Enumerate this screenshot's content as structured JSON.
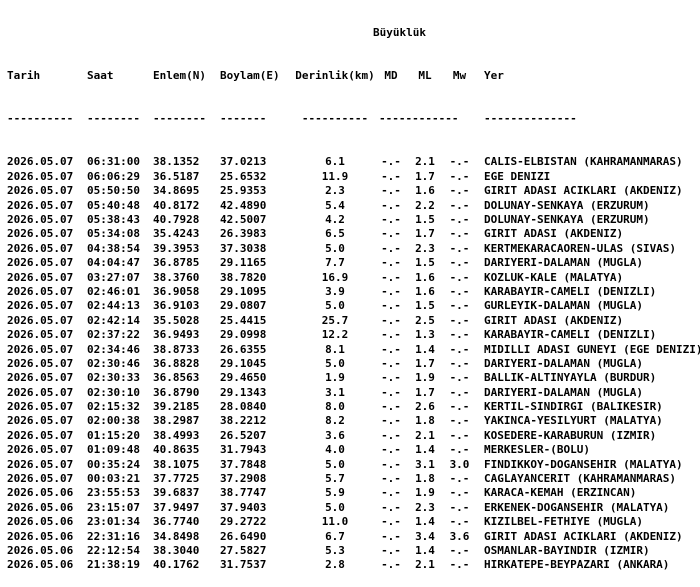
{
  "header": {
    "magnitude_group": "Büyüklük",
    "columns": {
      "date": "Tarih",
      "time": "Saat",
      "lat": "Enlem(N)",
      "lon": "Boylam(E)",
      "depth": "Derinlik(km)",
      "md": "MD",
      "ml": "ML",
      "mw": "Mw",
      "place": "Yer"
    },
    "rules": {
      "date": "----------",
      "time": "--------",
      "lat": "--------",
      "lon": "-------",
      "depth": "----------",
      "md": "------------",
      "ml": "",
      "mw": "",
      "place": "--------------"
    }
  },
  "rows": [
    {
      "date": "2026.05.07",
      "time": "06:31:00",
      "lat": "38.1352",
      "lon": "37.0213",
      "depth": "6.1",
      "md": "-.-",
      "ml": "2.1",
      "mw": "-.-",
      "place": "CALIS-ELBISTAN (KAHRAMANMARAS)"
    },
    {
      "date": "2026.05.07",
      "time": "06:06:29",
      "lat": "36.5187",
      "lon": "25.6532",
      "depth": "11.9",
      "md": "-.-",
      "ml": "1.7",
      "mw": "-.-",
      "place": "EGE DENIZI"
    },
    {
      "date": "2026.05.07",
      "time": "05:50:50",
      "lat": "34.8695",
      "lon": "25.9353",
      "depth": "2.3",
      "md": "-.-",
      "ml": "1.6",
      "mw": "-.-",
      "place": "GIRIT ADASI ACIKLARI (AKDENIZ)"
    },
    {
      "date": "2026.05.07",
      "time": "05:40:48",
      "lat": "40.8172",
      "lon": "42.4890",
      "depth": "5.4",
      "md": "-.-",
      "ml": "2.2",
      "mw": "-.-",
      "place": "DOLUNAY-SENKAYA (ERZURUM)"
    },
    {
      "date": "2026.05.07",
      "time": "05:38:43",
      "lat": "40.7928",
      "lon": "42.5007",
      "depth": "4.2",
      "md": "-.-",
      "ml": "1.5",
      "mw": "-.-",
      "place": "DOLUNAY-SENKAYA (ERZURUM)"
    },
    {
      "date": "2026.05.07",
      "time": "05:34:08",
      "lat": "35.4243",
      "lon": "26.3983",
      "depth": "6.5",
      "md": "-.-",
      "ml": "1.7",
      "mw": "-.-",
      "place": "GIRIT ADASI (AKDENIZ)"
    },
    {
      "date": "2026.05.07",
      "time": "04:38:54",
      "lat": "39.3953",
      "lon": "37.3038",
      "depth": "5.0",
      "md": "-.-",
      "ml": "2.3",
      "mw": "-.-",
      "place": "KERTMEKARACAOREN-ULAS (SIVAS)"
    },
    {
      "date": "2026.05.07",
      "time": "04:04:47",
      "lat": "36.8785",
      "lon": "29.1165",
      "depth": "7.7",
      "md": "-.-",
      "ml": "1.5",
      "mw": "-.-",
      "place": "DARIYERI-DALAMAN (MUGLA)"
    },
    {
      "date": "2026.05.07",
      "time": "03:27:07",
      "lat": "38.3760",
      "lon": "38.7820",
      "depth": "16.9",
      "md": "-.-",
      "ml": "1.6",
      "mw": "-.-",
      "place": "KOZLUK-KALE (MALATYA)"
    },
    {
      "date": "2026.05.07",
      "time": "02:46:01",
      "lat": "36.9058",
      "lon": "29.1095",
      "depth": "3.9",
      "md": "-.-",
      "ml": "1.6",
      "mw": "-.-",
      "place": "KARABAYIR-CAMELI (DENIZLI)"
    },
    {
      "date": "2026.05.07",
      "time": "02:44:13",
      "lat": "36.9103",
      "lon": "29.0807",
      "depth": "5.0",
      "md": "-.-",
      "ml": "1.5",
      "mw": "-.-",
      "place": "GURLEYIK-DALAMAN (MUGLA)"
    },
    {
      "date": "2026.05.07",
      "time": "02:42:14",
      "lat": "35.5028",
      "lon": "25.4415",
      "depth": "25.7",
      "md": "-.-",
      "ml": "2.5",
      "mw": "-.-",
      "place": "GIRIT ADASI (AKDENIZ)"
    },
    {
      "date": "2026.05.07",
      "time": "02:37:22",
      "lat": "36.9493",
      "lon": "29.0998",
      "depth": "12.2",
      "md": "-.-",
      "ml": "1.3",
      "mw": "-.-",
      "place": "KARABAYIR-CAMELI (DENIZLI)"
    },
    {
      "date": "2026.05.07",
      "time": "02:34:46",
      "lat": "38.8733",
      "lon": "26.6355",
      "depth": "8.1",
      "md": "-.-",
      "ml": "1.4",
      "mw": "-.-",
      "place": "MIDILLI ADASI GUNEYI (EGE DENIZI)"
    },
    {
      "date": "2026.05.07",
      "time": "02:30:46",
      "lat": "36.8828",
      "lon": "29.1045",
      "depth": "5.0",
      "md": "-.-",
      "ml": "1.7",
      "mw": "-.-",
      "place": "DARIYERI-DALAMAN (MUGLA)"
    },
    {
      "date": "2026.05.07",
      "time": "02:30:33",
      "lat": "36.8563",
      "lon": "29.4650",
      "depth": "1.9",
      "md": "-.-",
      "ml": "1.9",
      "mw": "-.-",
      "place": "BALLIK-ALTINYAYLA (BURDUR)"
    },
    {
      "date": "2026.05.07",
      "time": "02:30:10",
      "lat": "36.8790",
      "lon": "29.1343",
      "depth": "3.1",
      "md": "-.-",
      "ml": "1.7",
      "mw": "-.-",
      "place": "DARIYERI-DALAMAN (MUGLA)"
    },
    {
      "date": "2026.05.07",
      "time": "02:15:32",
      "lat": "39.2185",
      "lon": "28.0840",
      "depth": "8.0",
      "md": "-.-",
      "ml": "2.6",
      "mw": "-.-",
      "place": "KERTIL-SINDIRGI (BALIKESIR)"
    },
    {
      "date": "2026.05.07",
      "time": "02:00:38",
      "lat": "38.2987",
      "lon": "38.2212",
      "depth": "8.2",
      "md": "-.-",
      "ml": "1.8",
      "mw": "-.-",
      "place": "YAKINCA-YESILYURT (MALATYA)"
    },
    {
      "date": "2026.05.07",
      "time": "01:15:20",
      "lat": "38.4993",
      "lon": "26.5207",
      "depth": "3.6",
      "md": "-.-",
      "ml": "2.1",
      "mw": "-.-",
      "place": "KOSEDERE-KARABURUN (IZMIR)"
    },
    {
      "date": "2026.05.07",
      "time": "01:09:48",
      "lat": "40.8635",
      "lon": "31.7943",
      "depth": "4.0",
      "md": "-.-",
      "ml": "1.4",
      "mw": "-.-",
      "place": "MERKESLER-(BOLU)"
    },
    {
      "date": "2026.05.07",
      "time": "00:35:24",
      "lat": "38.1075",
      "lon": "37.7848",
      "depth": "5.0",
      "md": "-.-",
      "ml": "3.1",
      "mw": "3.0",
      "place": "FINDIKKOY-DOGANSEHIR (MALATYA)"
    },
    {
      "date": "2026.05.07",
      "time": "00:03:21",
      "lat": "37.7725",
      "lon": "37.2908",
      "depth": "5.7",
      "md": "-.-",
      "ml": "1.8",
      "mw": "-.-",
      "place": "CAGLAYANCERIT (KAHRAMANMARAS)"
    },
    {
      "date": "2026.05.06",
      "time": "23:55:53",
      "lat": "39.6837",
      "lon": "38.7747",
      "depth": "5.9",
      "md": "-.-",
      "ml": "1.9",
      "mw": "-.-",
      "place": "KARACA-KEMAH (ERZINCAN)"
    },
    {
      "date": "2026.05.06",
      "time": "23:15:07",
      "lat": "37.9497",
      "lon": "37.9403",
      "depth": "5.0",
      "md": "-.-",
      "ml": "2.3",
      "mw": "-.-",
      "place": "ERKENEK-DOGANSEHIR (MALATYA)"
    },
    {
      "date": "2026.05.06",
      "time": "23:01:34",
      "lat": "36.7740",
      "lon": "29.2722",
      "depth": "11.0",
      "md": "-.-",
      "ml": "1.4",
      "mw": "-.-",
      "place": "KIZILBEL-FETHIYE (MUGLA)"
    },
    {
      "date": "2026.05.06",
      "time": "22:31:16",
      "lat": "34.8498",
      "lon": "26.6490",
      "depth": "6.7",
      "md": "-.-",
      "ml": "3.4",
      "mw": "3.6",
      "place": "GIRIT ADASI ACIKLARI (AKDENIZ)"
    },
    {
      "date": "2026.05.06",
      "time": "22:12:54",
      "lat": "38.3040",
      "lon": "27.5827",
      "depth": "5.3",
      "md": "-.-",
      "ml": "1.4",
      "mw": "-.-",
      "place": "OSMANLAR-BAYINDIR (IZMIR)"
    },
    {
      "date": "2026.05.06",
      "time": "21:38:19",
      "lat": "40.1762",
      "lon": "31.7537",
      "depth": "2.8",
      "md": "-.-",
      "ml": "2.1",
      "mw": "-.-",
      "place": "HIRKATEPE-BEYPAZARI (ANKARA)"
    }
  ]
}
